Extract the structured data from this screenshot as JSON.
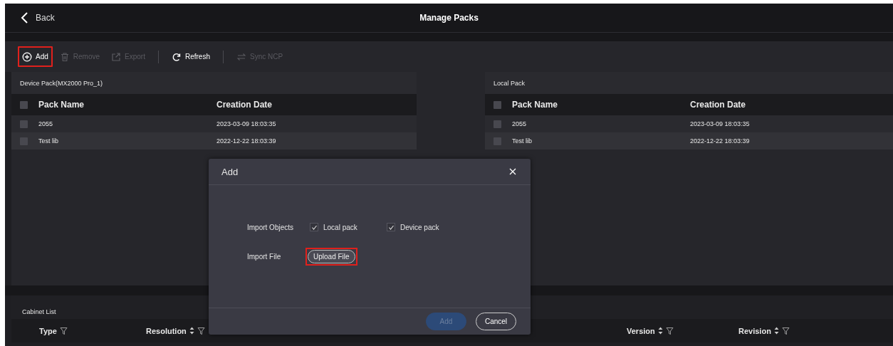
{
  "header": {
    "back_label": "Back",
    "title": "Manage Packs"
  },
  "toolbar": [
    {
      "kind": "add",
      "label": "Add",
      "disabled": false,
      "highlighted": true,
      "divider_before": false
    },
    {
      "kind": "remove",
      "label": "Remove",
      "disabled": true,
      "highlighted": false,
      "divider_before": false
    },
    {
      "kind": "export",
      "label": "Export",
      "disabled": true,
      "highlighted": false,
      "divider_before": false
    },
    {
      "kind": "refresh",
      "label": "Refresh",
      "disabled": false,
      "highlighted": false,
      "divider_before": true
    },
    {
      "kind": "sync",
      "label": "Sync NCP",
      "disabled": true,
      "highlighted": false,
      "divider_before": true
    }
  ],
  "panels": [
    {
      "title": "Device Pack(MX2000 Pro_1)",
      "columns": [
        "Pack Name",
        "Creation Date"
      ],
      "all_checked": false,
      "rows": [
        {
          "name": "2055",
          "date": "2023-03-09 18:03:35",
          "checked": false
        },
        {
          "name": "Test lib",
          "date": "2022-12-22 18:03:39",
          "checked": false
        }
      ]
    },
    {
      "title": "Local Pack",
      "columns": [
        "Pack Name",
        "Creation Date"
      ],
      "all_checked": false,
      "rows": [
        {
          "name": "2055",
          "date": "2023-03-09 18:03:35",
          "checked": false
        },
        {
          "name": "Test lib",
          "date": "2022-12-22 18:03:39",
          "checked": false
        }
      ]
    }
  ],
  "cabinet_list": {
    "title": "Cabinet List",
    "columns": [
      {
        "label": "Type",
        "sortable": false,
        "filterable": true
      },
      {
        "label": "Resolution",
        "sortable": true,
        "filterable": true
      },
      {
        "label": "Version",
        "sortable": true,
        "filterable": true
      },
      {
        "label": "Revision",
        "sortable": true,
        "filterable": true
      }
    ]
  },
  "dialog": {
    "title": "Add",
    "import_objects_label": "Import Objects",
    "options": [
      {
        "label": "Local pack",
        "checked": true
      },
      {
        "label": "Device pack",
        "checked": true
      }
    ],
    "import_file_label": "Import File",
    "upload_button": {
      "label": "Upload File",
      "highlighted": true
    },
    "buttons": [
      {
        "kind": "primary",
        "label": "Add",
        "disabled": true
      },
      {
        "kind": "secondary",
        "label": "Cancel",
        "disabled": false
      }
    ]
  }
}
